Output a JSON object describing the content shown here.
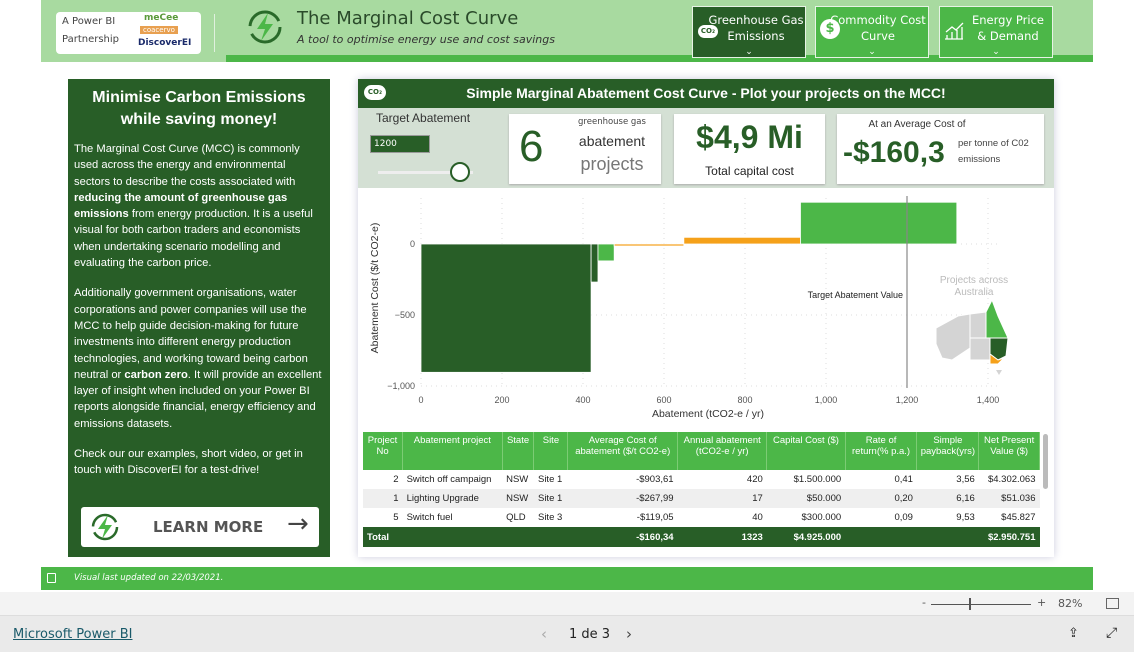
{
  "header": {
    "partnership_line1": "A Power BI",
    "partnership_line2": "Partnership",
    "logos": [
      "meCee",
      "coacervo",
      "DiscoverEI"
    ],
    "title_pre": "The ",
    "title_main": "Marginal Cost Curve",
    "subtitle": "A tool to optimise energy use and cost savings",
    "nav": [
      {
        "label1": "Greenhouse Gas",
        "label2": "Emissions",
        "icon": "co2-cloud-icon",
        "active": true
      },
      {
        "label1": "Commodity Cost",
        "label2": "Curve",
        "icon": "dollar-icon",
        "active": false
      },
      {
        "label1": "Energy Price",
        "label2": "& Demand",
        "icon": "bar-chart-icon",
        "active": false
      }
    ]
  },
  "left": {
    "heading": "Minimise Carbon Emissions while saving money!",
    "p1a": "The Marginal Cost Curve (MCC) is commonly used across the energy and environmental sectors to describe the costs associated with ",
    "p1b": "reducing the amount of greenhouse gas emissions",
    "p1c": " from energy production. It is a useful visual for both carbon traders and economists when undertaking scenario modelling and evaluating the carbon price.",
    "p2a": "Additionally government organisations, water corporations and power companies will use the MCC to help guide decision-making for future investments into different energy production technologies, and working toward being carbon neutral or ",
    "p2b": "carbon zero",
    "p2c": ". It will provide an excellent layer of insight when included on your Power BI reports alongside financial, energy efficiency and emissions datasets.",
    "p3": "Check our our examples, short video, or get in touch with DiscoverEI for a test-drive!",
    "button": "LEARN MORE"
  },
  "visual": {
    "title": "Simple Marginal Abatement Cost Curve - Plot your projects on the MCC!",
    "target": {
      "label": "Target Abatement",
      "value": "1200",
      "slider_fraction": 0.86
    },
    "kpi1": {
      "value": "6",
      "l1": "greenhouse gas",
      "l2": "abatement",
      "l3": "projects"
    },
    "kpi2": {
      "value": "$4,9 Mi",
      "label": "Total capital cost"
    },
    "kpi3": {
      "top": "At an Average Cost of",
      "value": "-$160,3",
      "r1": "per tonne of C02",
      "r2": "emissions"
    },
    "map_label1": "Projects across",
    "map_label2": "Australia",
    "target_line_label": "Target Abatement Value"
  },
  "chart_data": {
    "type": "bar",
    "subtype": "variable-width marginal abatement cost curve",
    "xlabel": "Abatement (tCO2-e / yr)",
    "ylabel": "Abatement Cost ($/t CO2-e)",
    "xlim": [
      0,
      1400
    ],
    "ylim": [
      -1000,
      300
    ],
    "xticks": [
      "0",
      "200",
      "400",
      "600",
      "800",
      "1,000",
      "1,200",
      "1,400"
    ],
    "yticks": [
      "0",
      "−500",
      "−1,000"
    ],
    "grid": true,
    "target_line": 1200,
    "bars": [
      {
        "width": 420,
        "value": -903.61,
        "color": "#285e27"
      },
      {
        "width": 17,
        "value": -267.99,
        "color": "#285e27"
      },
      {
        "width": 40,
        "value": -119.05,
        "color": "#4cb748"
      },
      {
        "width": 172,
        "value": -5,
        "color": "#f5a11a"
      },
      {
        "width": 288,
        "value": 47,
        "color": "#f5a11a"
      },
      {
        "width": 386,
        "value": 294,
        "color": "#4cb748"
      }
    ]
  },
  "table": {
    "headers": [
      "Project No",
      "Abatement project",
      "State",
      "Site",
      "Average Cost of abatement ($/t CO2-e)",
      "Annual abatement (tCO2-e / yr)",
      "Capital Cost ($)",
      "Rate of return(% p.a.)",
      "Simple payback(yrs)",
      "Net Present Value ($)"
    ],
    "rows": [
      [
        "2",
        "Switch off campaign",
        "NSW",
        "Site 1",
        "-$903,61",
        "420",
        "$1.500.000",
        "0,41",
        "3,56",
        "$4.302.063"
      ],
      [
        "1",
        "Lighting Upgrade",
        "NSW",
        "Site 1",
        "-$267,99",
        "17",
        "$50.000",
        "0,20",
        "6,16",
        "$51.036"
      ],
      [
        "5",
        "Switch fuel",
        "QLD",
        "Site 3",
        "-$119,05",
        "40",
        "$300.000",
        "0,09",
        "9,53",
        "$45.827"
      ]
    ],
    "total": [
      "Total",
      "",
      "",
      "",
      "-$160,34",
      "1323",
      "$4.925.000",
      "",
      "",
      "$2.950.751"
    ]
  },
  "footer": {
    "updated": "Visual last updated on 22/03/2021."
  },
  "zoom": {
    "minus": "-",
    "plus": "+",
    "level": "82%"
  },
  "bottom": {
    "brand": "Microsoft Power BI",
    "page": "1 de 3"
  },
  "colors": {
    "dark_green": "#285e27",
    "green": "#4cb748",
    "light_green": "#a8daa0",
    "orange": "#f5a11a"
  }
}
